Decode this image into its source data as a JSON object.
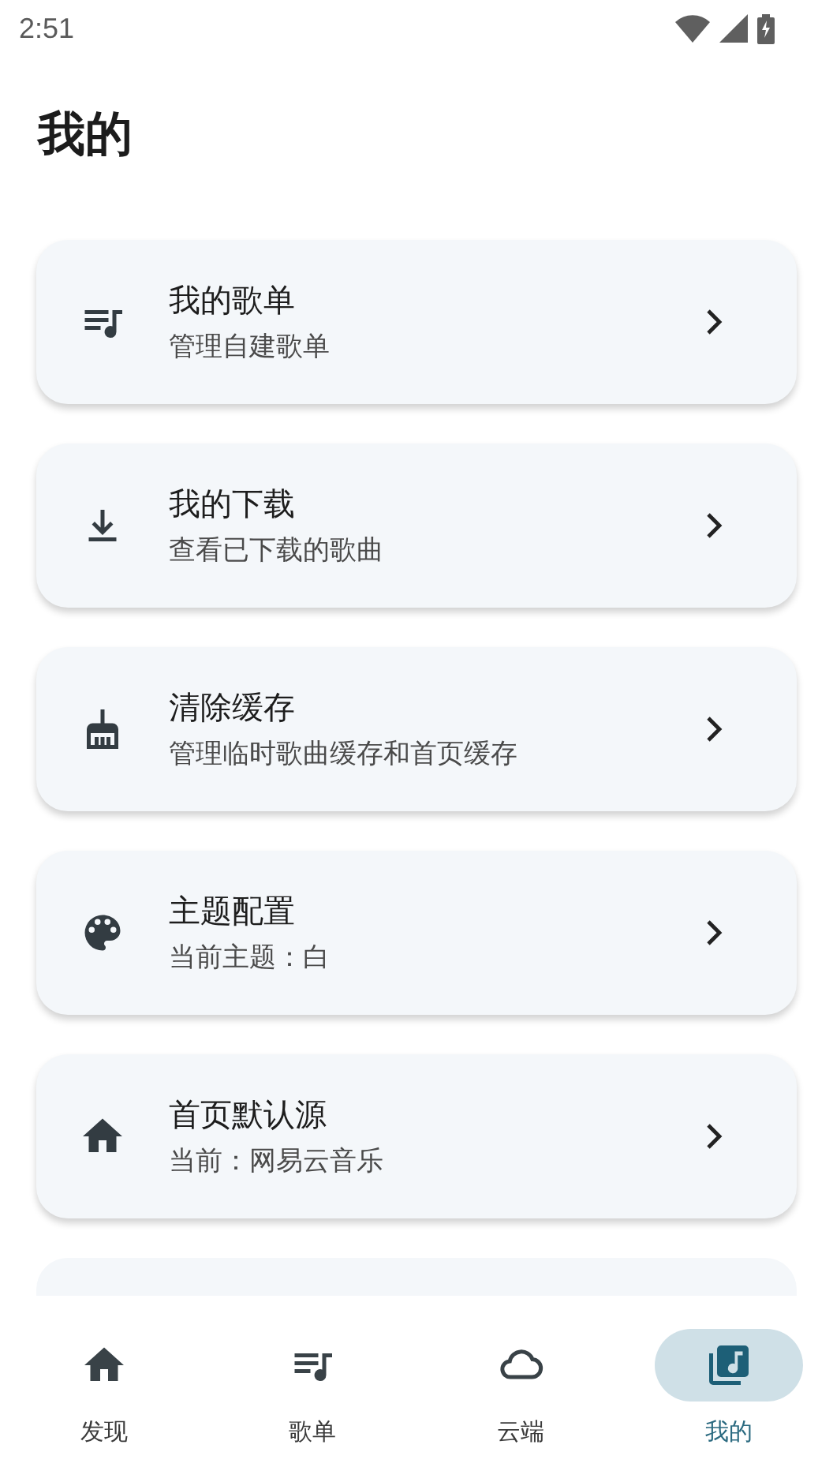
{
  "status_bar": {
    "time": "2:51"
  },
  "page_title": "我的",
  "menu": [
    {
      "kind": "playlist",
      "title": "我的歌单",
      "subtitle": "管理自建歌单"
    },
    {
      "kind": "download",
      "title": "我的下载",
      "subtitle": "查看已下载的歌曲"
    },
    {
      "kind": "broom",
      "title": "清除缓存",
      "subtitle": "管理临时歌曲缓存和首页缓存"
    },
    {
      "kind": "palette",
      "title": "主题配置",
      "subtitle": "当前主题：白"
    },
    {
      "kind": "home",
      "title": "首页默认源",
      "subtitle": "当前：网易云音乐"
    }
  ],
  "bottom_nav": [
    {
      "kind": "home",
      "label": "发现",
      "selected": false
    },
    {
      "kind": "playlist",
      "label": "歌单",
      "selected": false
    },
    {
      "kind": "cloud",
      "label": "云端",
      "selected": false
    },
    {
      "kind": "library",
      "label": "我的",
      "selected": true
    }
  ]
}
